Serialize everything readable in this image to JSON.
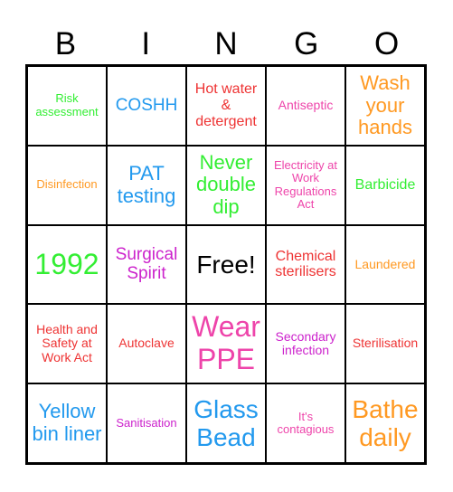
{
  "header": {
    "letters": [
      "B",
      "I",
      "N",
      "G",
      "O"
    ]
  },
  "colors": {
    "green": "#33ee33",
    "blue": "#2299ee",
    "red": "#ee3333",
    "pink": "#ee44aa",
    "orange": "#ff9922",
    "purple": "#cc22cc",
    "black": "#000000"
  },
  "grid": {
    "rows": [
      [
        {
          "text": "Risk assessment",
          "color": "green"
        },
        {
          "text": "COSHH",
          "color": "blue"
        },
        {
          "text": "Hot water & detergent",
          "color": "red"
        },
        {
          "text": "Antiseptic",
          "color": "pink"
        },
        {
          "text": "Wash your hands",
          "color": "orange"
        }
      ],
      [
        {
          "text": "Disinfection",
          "color": "orange"
        },
        {
          "text": "PAT testing",
          "color": "blue"
        },
        {
          "text": "Never double dip",
          "color": "green"
        },
        {
          "text": "Electricity at Work Regulations Act",
          "color": "pink"
        },
        {
          "text": "Barbicide",
          "color": "green"
        }
      ],
      [
        {
          "text": "1992",
          "color": "green"
        },
        {
          "text": "Surgical Spirit",
          "color": "purple"
        },
        {
          "text": "Free!",
          "color": "black"
        },
        {
          "text": "Chemical sterilisers",
          "color": "red"
        },
        {
          "text": "Laundered",
          "color": "orange"
        }
      ],
      [
        {
          "text": "Health and Safety at Work Act",
          "color": "red"
        },
        {
          "text": "Autoclave",
          "color": "red"
        },
        {
          "text": "Wear PPE",
          "color": "pink"
        },
        {
          "text": "Secondary infection",
          "color": "purple"
        },
        {
          "text": "Sterilisation",
          "color": "red"
        }
      ],
      [
        {
          "text": "Yellow bin liner",
          "color": "blue"
        },
        {
          "text": "Sanitisation",
          "color": "purple"
        },
        {
          "text": "Glass Bead",
          "color": "blue"
        },
        {
          "text": "It's contagious",
          "color": "pink"
        },
        {
          "text": "Bathe daily",
          "color": "orange"
        }
      ]
    ]
  }
}
